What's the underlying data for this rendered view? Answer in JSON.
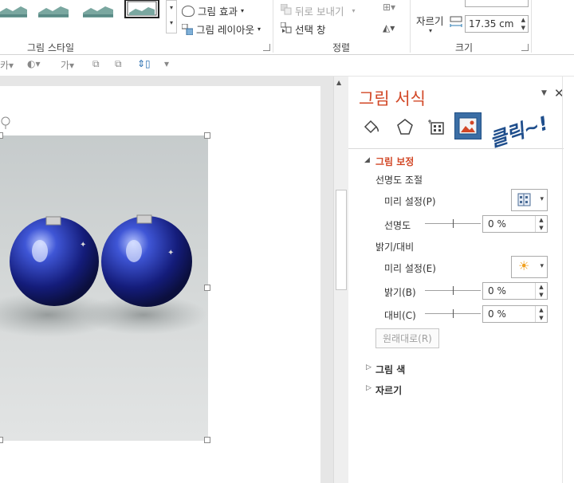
{
  "ribbon": {
    "picture_effects": "그림 효과",
    "picture_layout": "그림 레이아웃",
    "picture_styles_group": "그림 스타일",
    "send_backward": "뒤로 보내기",
    "selection_pane": "선택 창",
    "arrange_group": "정렬",
    "crop": "자르기",
    "width_value": "17.35 cm",
    "size_group": "크기"
  },
  "pane": {
    "title": "그림 서식",
    "annotation": "클릭~!",
    "correction": {
      "header": "그림 보정",
      "sharpen_heading": "선명도 조절",
      "sharpen_preset_label": "미리 설정(P)",
      "sharpness_label": "선명도",
      "sharpness_value": "0 %",
      "bright_heading": "밝기/대비",
      "bright_preset_label": "미리 설정(E)",
      "brightness_label": "밝기(B)",
      "brightness_value": "0 %",
      "contrast_label": "대비(C)",
      "contrast_value": "0 %",
      "reset_label": "원래대로(R)"
    },
    "picture_color": "그림 색",
    "crop_section": "자르기"
  },
  "colors": {
    "accent": "#d24726",
    "tab_selected_bg": "#3b6ea5",
    "annotation": "#1f4e8c"
  }
}
